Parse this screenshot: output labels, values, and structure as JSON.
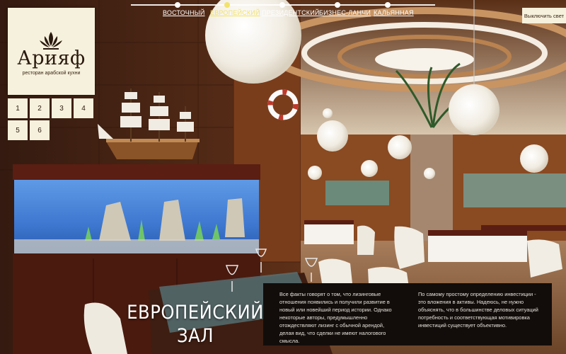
{
  "nav": {
    "items": [
      {
        "label": "ВОСТОЧНЫЙ",
        "active": false
      },
      {
        "label": "ЕВРОПЕЙСКИЙ",
        "active": true
      },
      {
        "label": "ПРЕЗИДЕНТСКИЙ",
        "active": false
      },
      {
        "label": "БИЗНЕС-ЛАНЧИ",
        "active": false
      },
      {
        "label": "КАЛЬЯННАЯ",
        "active": false
      }
    ],
    "active_color": "#f2e36a"
  },
  "logo": {
    "name": "Арияф",
    "subtitle": "ресторан арабской кухни",
    "icon": "lotus-ornament-icon"
  },
  "pager": {
    "pages": [
      "1",
      "2",
      "3",
      "4",
      "5",
      "6"
    ]
  },
  "light_button": {
    "label": "Выключить свет"
  },
  "hall": {
    "title_line1": "ЕВРОПЕЙСКИЙ",
    "title_line2": "ЗАЛ"
  },
  "info": {
    "col1": "Все факты говорят о том, что лизинговые отношения появились и получили развитие в новый или новейший период истории. Однако некоторые авторы, предумышленно отождествляют лизинг с обычной арендой, делая вид, что сделки не имеют налогового смысла.",
    "col2": "По самому простому определению инвестиции - это вложения в активы. Надеюсь, не нужно объяснять, что в большинстве деловых ситуаций потребность и соответствующая мотивировка инвестиций существует объективно."
  },
  "colors": {
    "panel_bg": "#f6f1dc",
    "info_bg": "#120d0b",
    "accent": "#f2e36a"
  }
}
